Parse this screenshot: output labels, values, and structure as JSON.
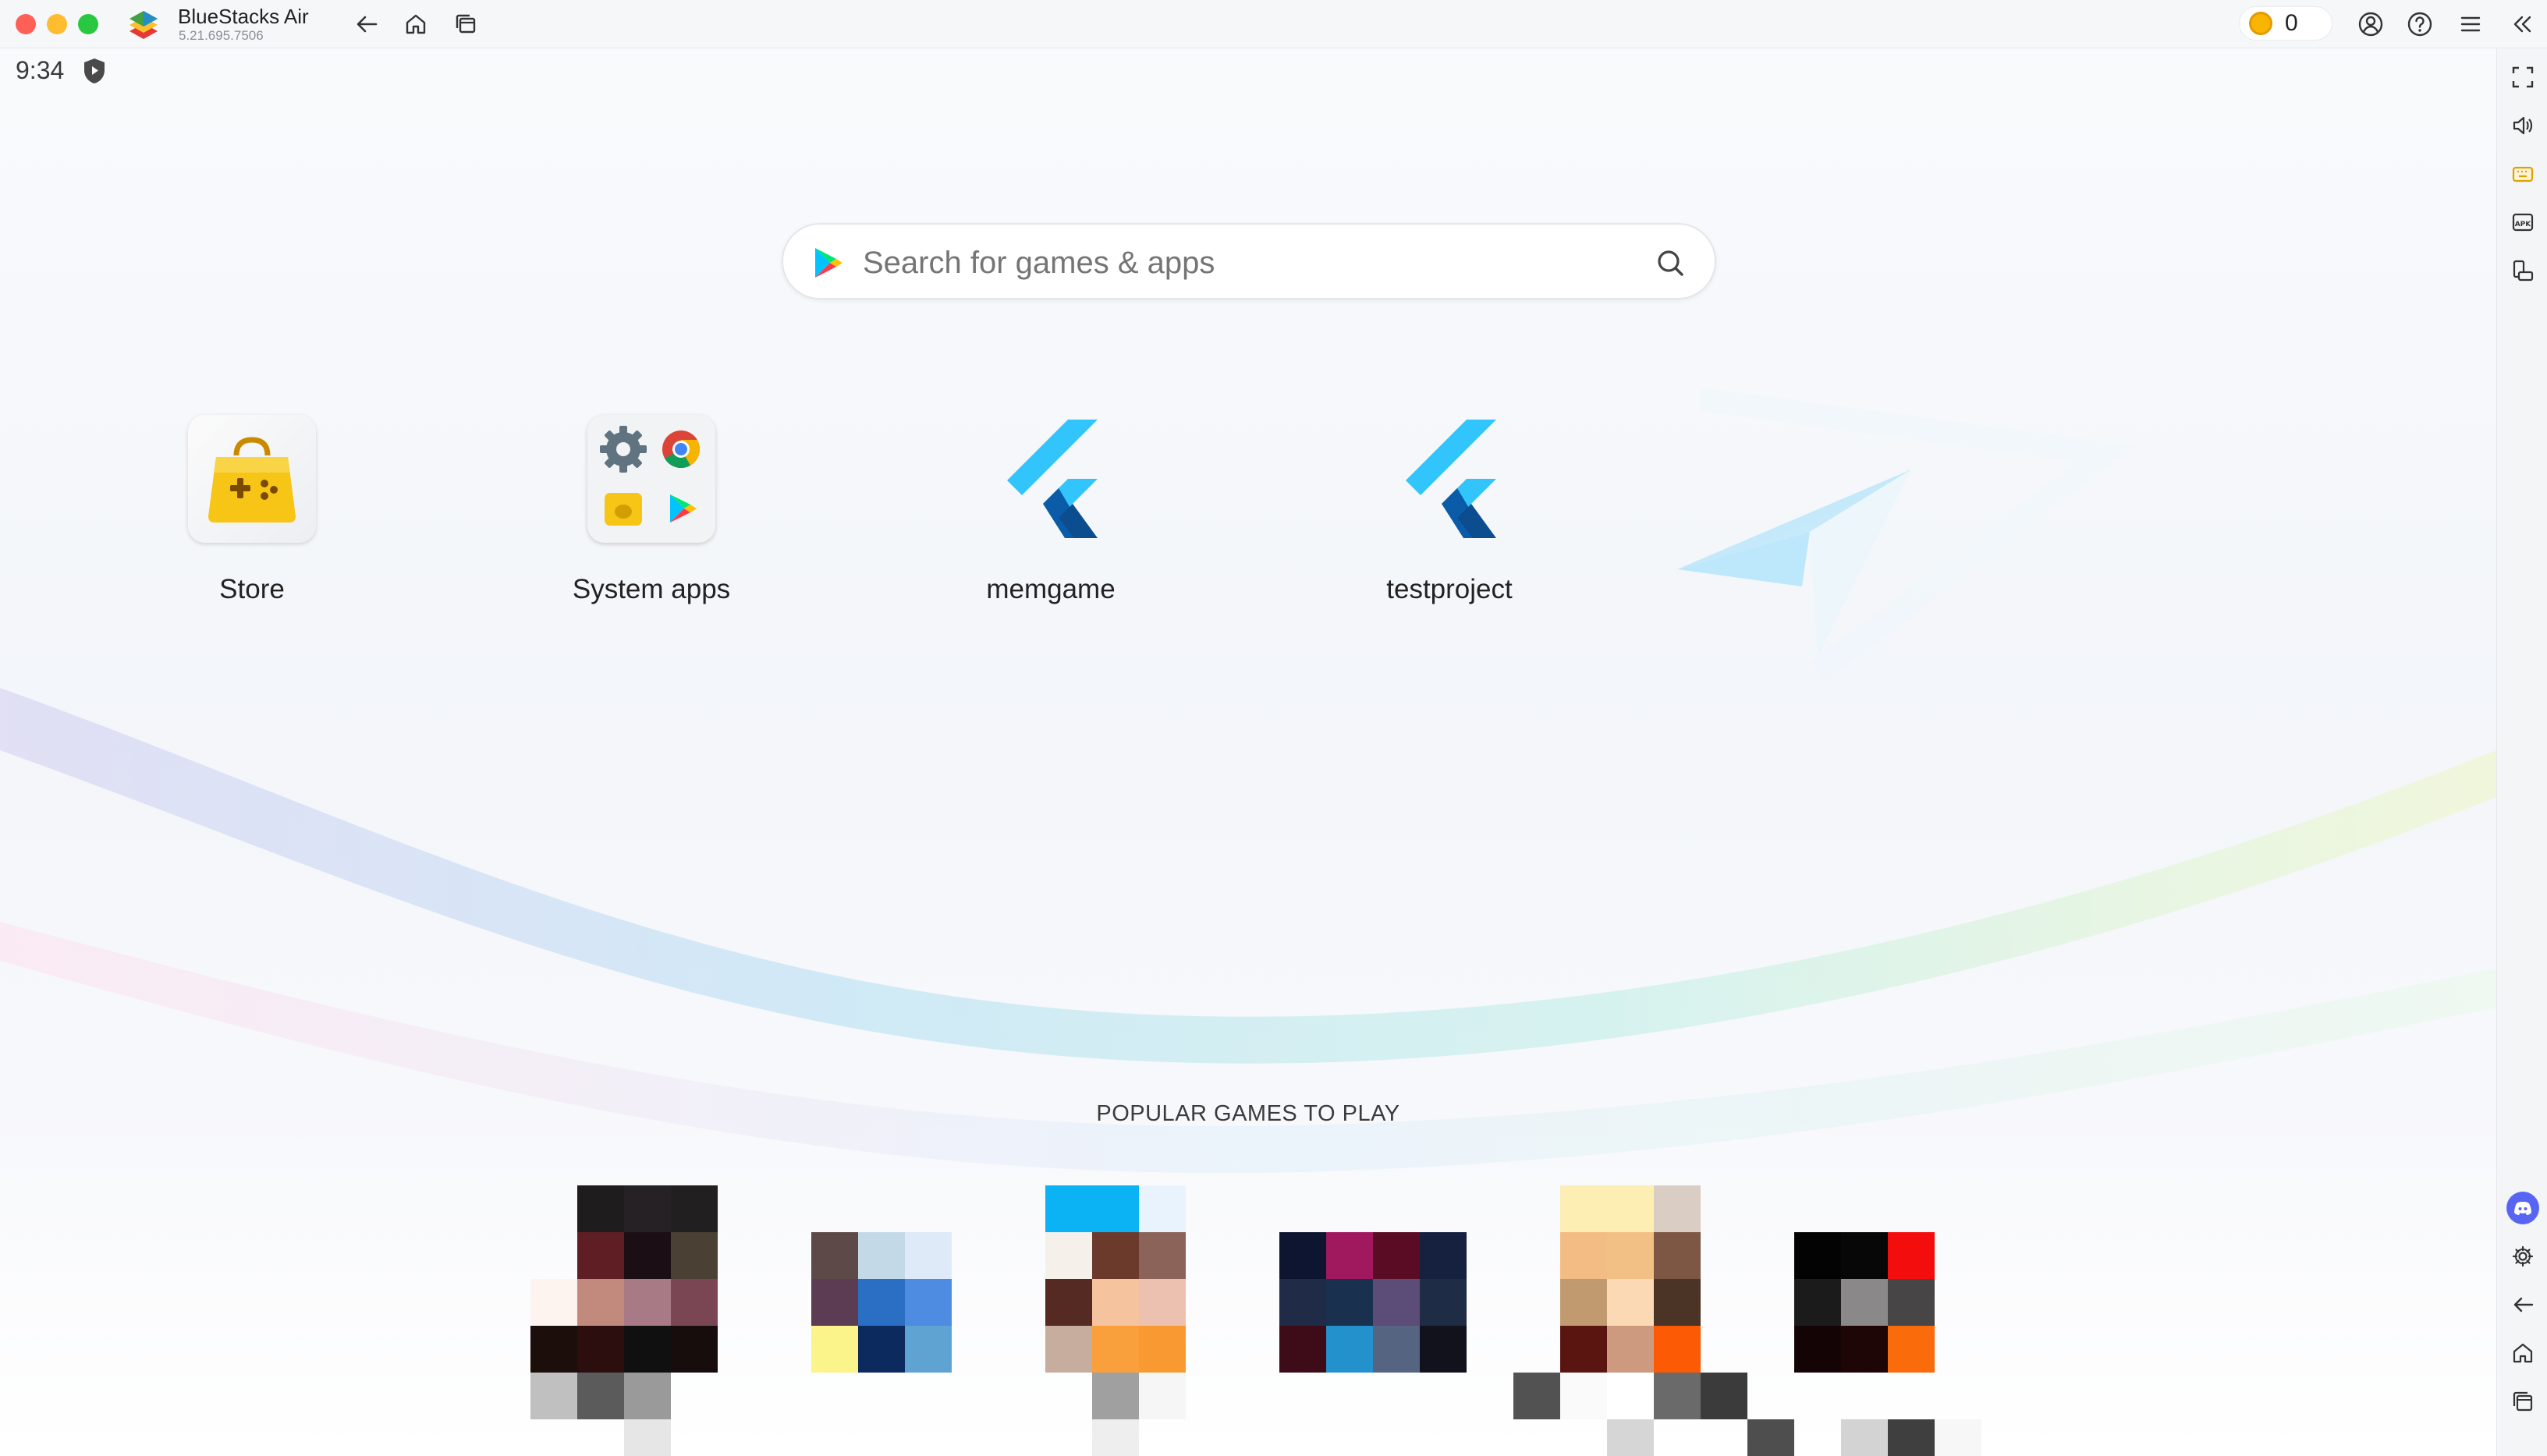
{
  "window": {
    "app_name": "BlueStacks Air",
    "version": "5.21.695.7506"
  },
  "toolbar": {
    "back_icon": "arrow-left-icon",
    "home_icon": "home-icon",
    "multi_instance_icon": "multi-window-icon",
    "coins": "0",
    "account_icon": "account-icon",
    "help_icon": "help-icon",
    "menu_icon": "hamburger-icon",
    "collapse_icon": "double-chevron-left-icon"
  },
  "status_bar": {
    "time": "9:34",
    "shield_icon": "play-protect-icon"
  },
  "search": {
    "placeholder": "Search for games & apps"
  },
  "apps": [
    {
      "label": "Store",
      "icon": "store-bag-icon"
    },
    {
      "label": "System apps",
      "icon": "system-apps-folder-icon"
    },
    {
      "label": "memgame",
      "icon": "flutter-icon"
    },
    {
      "label": "testproject",
      "icon": "flutter-icon"
    }
  ],
  "popular": {
    "title": "POPULAR GAMES TO PLAY"
  },
  "sidebar": {
    "items": [
      "fullscreen-icon",
      "volume-icon",
      "keyboard-controls-icon",
      "install-apk-icon",
      "rotate-icon",
      "discord-icon",
      "settings-icon",
      "back-icon",
      "home-icon",
      "recent-apps-icon"
    ]
  },
  "colors": {
    "accent_blue": "#1aa0f7",
    "flutter_light": "#32c5fc",
    "flutter_dark": "#0a5ba8",
    "store_yellow": "#f7c515"
  }
}
